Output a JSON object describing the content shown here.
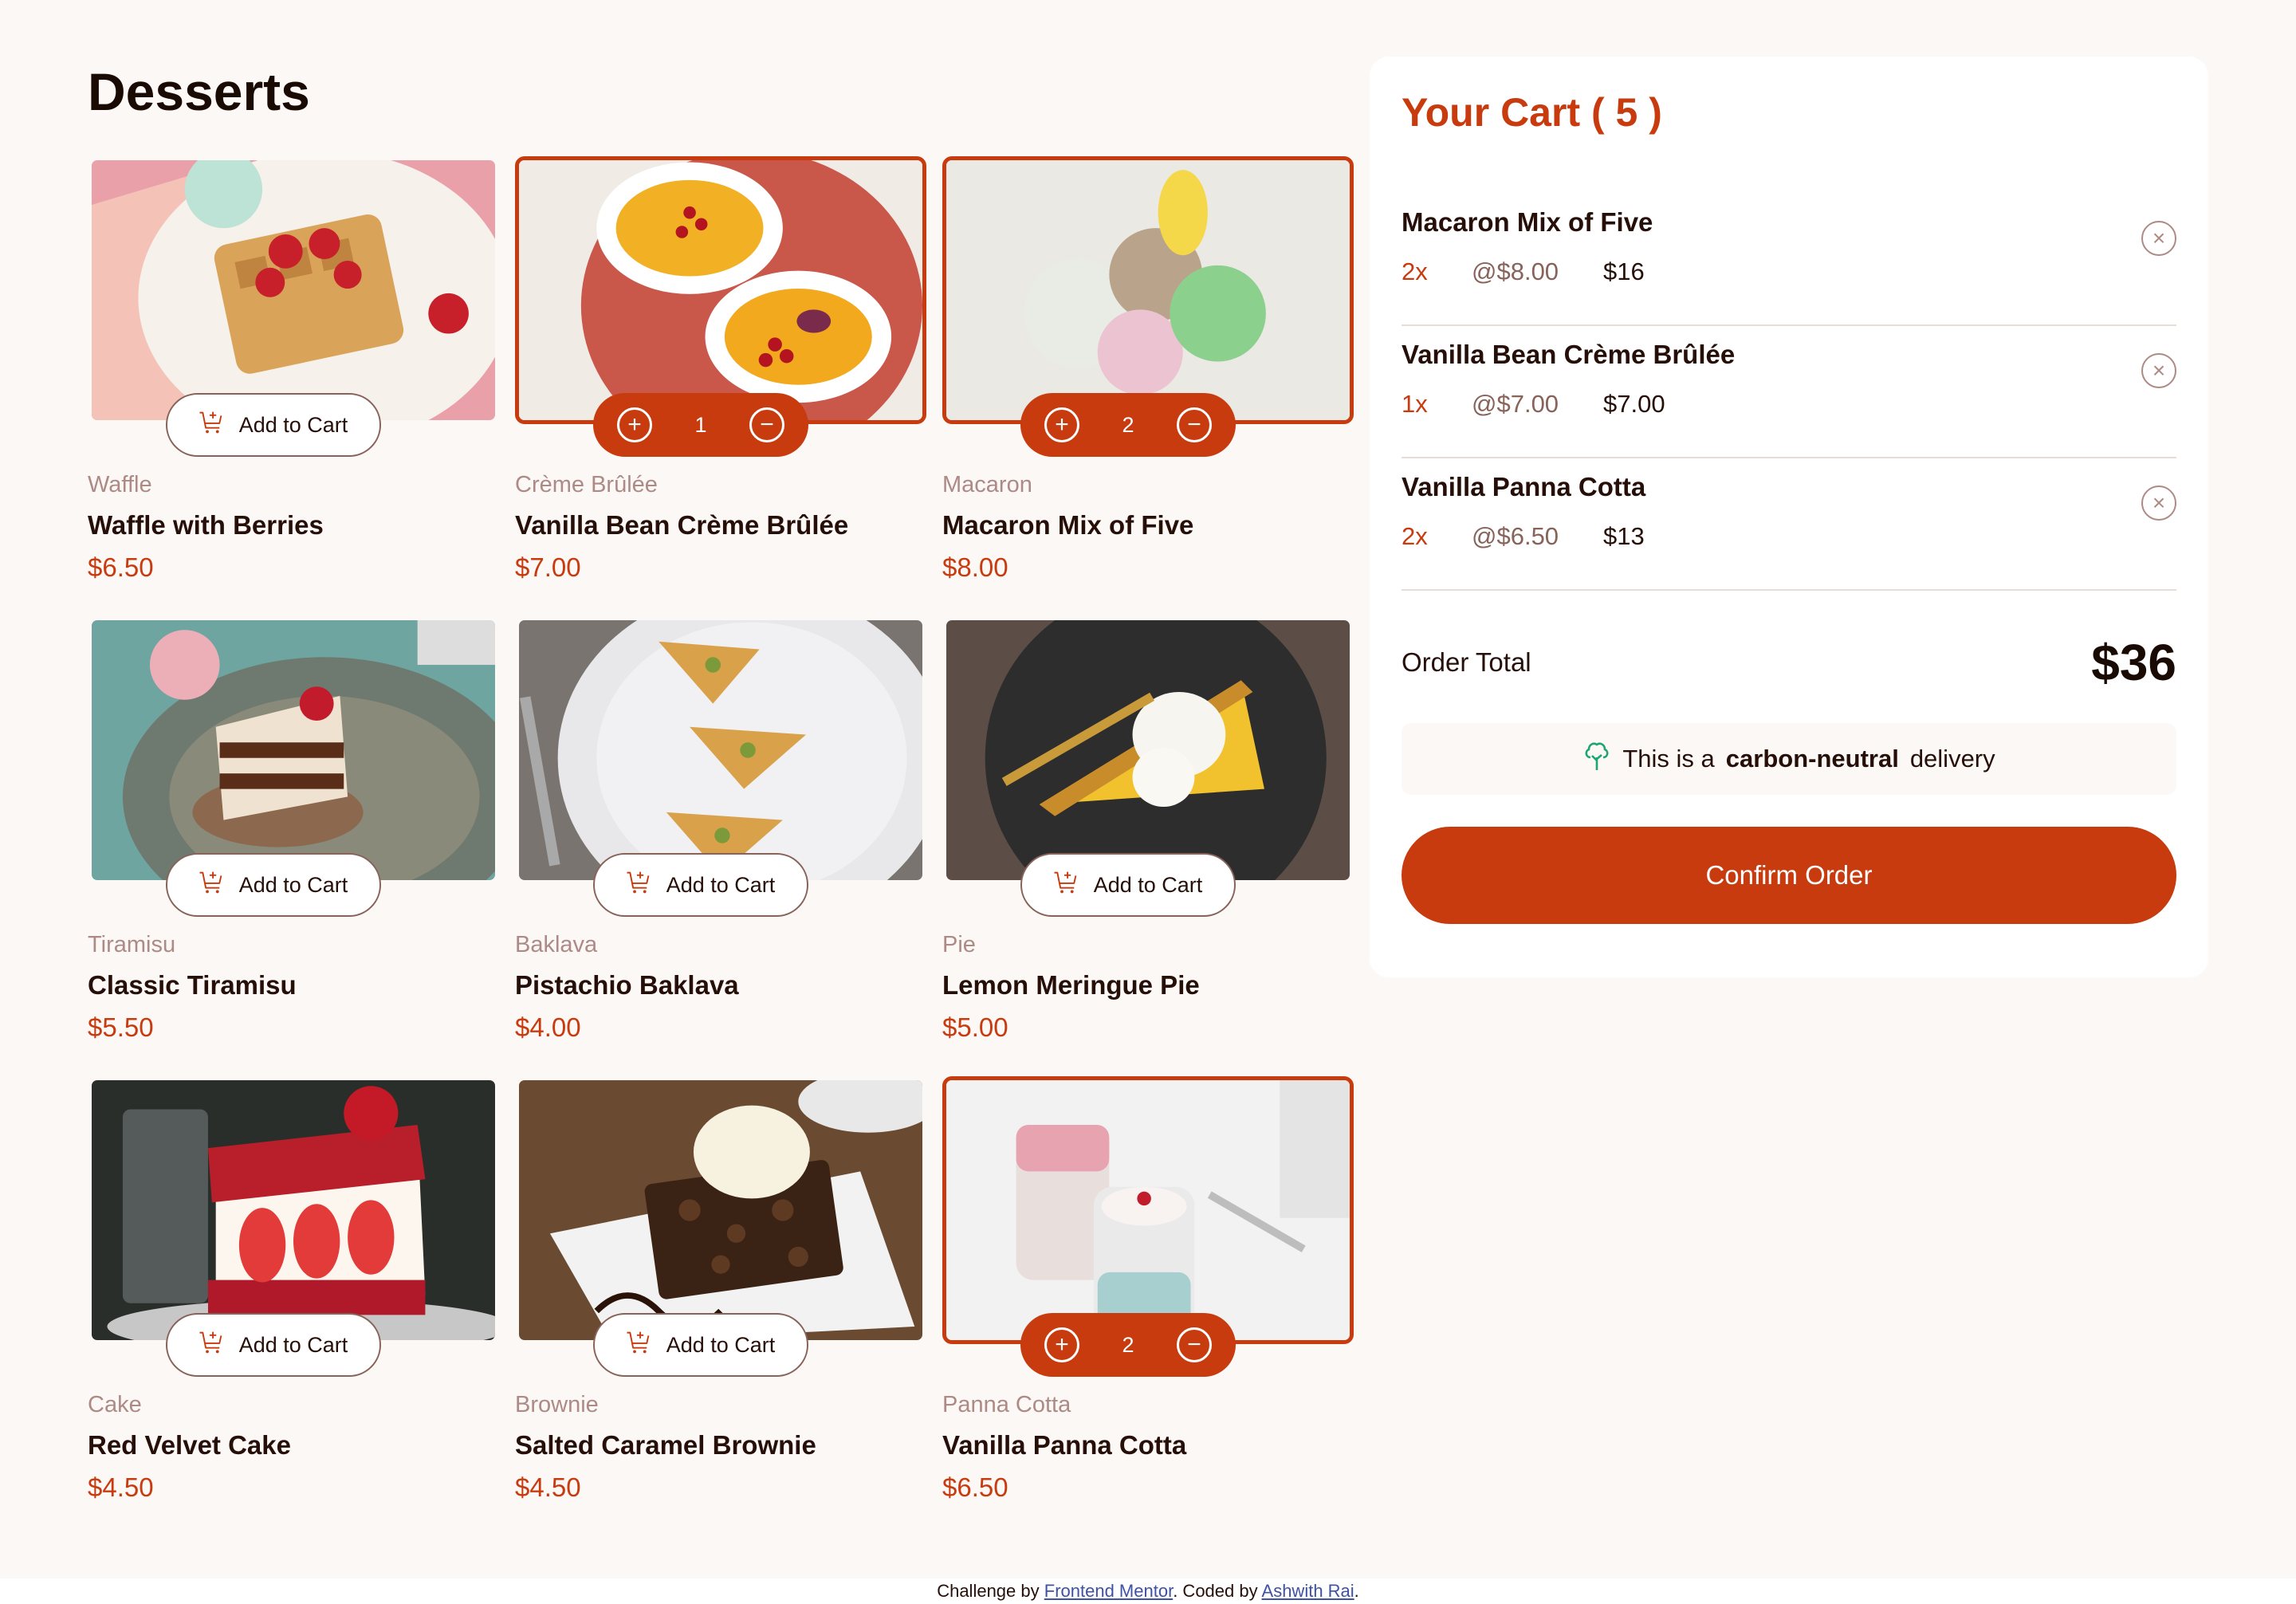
{
  "page": {
    "title": "Desserts"
  },
  "products": [
    {
      "category": "Waffle",
      "name": "Waffle with Berries",
      "price": "$6.50",
      "add_label": "Add to Cart",
      "selected": false,
      "qty": null,
      "image": "waffle"
    },
    {
      "category": "Crème Brûlée",
      "name": "Vanilla Bean Crème Brûlée",
      "price": "$7.00",
      "add_label": "Add to Cart",
      "selected": true,
      "qty": "1",
      "image": "creme-brulee"
    },
    {
      "category": "Macaron",
      "name": "Macaron Mix of Five",
      "price": "$8.00",
      "add_label": "Add to Cart",
      "selected": true,
      "qty": "2",
      "image": "macaron"
    },
    {
      "category": "Tiramisu",
      "name": "Classic Tiramisu",
      "price": "$5.50",
      "add_label": "Add to Cart",
      "selected": false,
      "qty": null,
      "image": "tiramisu"
    },
    {
      "category": "Baklava",
      "name": "Pistachio Baklava",
      "price": "$4.00",
      "add_label": "Add to Cart",
      "selected": false,
      "qty": null,
      "image": "baklava"
    },
    {
      "category": "Pie",
      "name": "Lemon Meringue Pie",
      "price": "$5.00",
      "add_label": "Add to Cart",
      "selected": false,
      "qty": null,
      "image": "pie"
    },
    {
      "category": "Cake",
      "name": "Red Velvet Cake",
      "price": "$4.50",
      "add_label": "Add to Cart",
      "selected": false,
      "qty": null,
      "image": "cake"
    },
    {
      "category": "Brownie",
      "name": "Salted Caramel Brownie",
      "price": "$4.50",
      "add_label": "Add to Cart",
      "selected": false,
      "qty": null,
      "image": "brownie"
    },
    {
      "category": "Panna Cotta",
      "name": "Vanilla Panna Cotta",
      "price": "$6.50",
      "add_label": "Add to Cart",
      "selected": true,
      "qty": "2",
      "image": "panna-cotta"
    }
  ],
  "cart": {
    "title": "Your Cart ( 5 )",
    "items": [
      {
        "name": "Macaron Mix of Five",
        "qty": "2x",
        "unit": "@$8.00",
        "total": "$16"
      },
      {
        "name": "Vanilla Bean Crème Brûlée",
        "qty": "1x",
        "unit": "@$7.00",
        "total": "$7.00"
      },
      {
        "name": "Vanilla Panna Cotta",
        "qty": "2x",
        "unit": "@$6.50",
        "total": "$13"
      }
    ],
    "order_total_label": "Order Total",
    "order_total": "$36",
    "carbon_pre": "This is a",
    "carbon_bold": "carbon-neutral",
    "carbon_post": "delivery",
    "confirm_label": "Confirm Order"
  },
  "footer": {
    "pre": "Challenge by",
    "link1": "Frontend Mentor",
    "mid": ". Coded by",
    "link2": "Ashwith Rai",
    "post": "."
  },
  "colors": {
    "accent": "#c73b0f",
    "rose": "#ad8a85",
    "text": "#260f08",
    "bg": "#fcf8f6",
    "green": "#1ea475"
  }
}
